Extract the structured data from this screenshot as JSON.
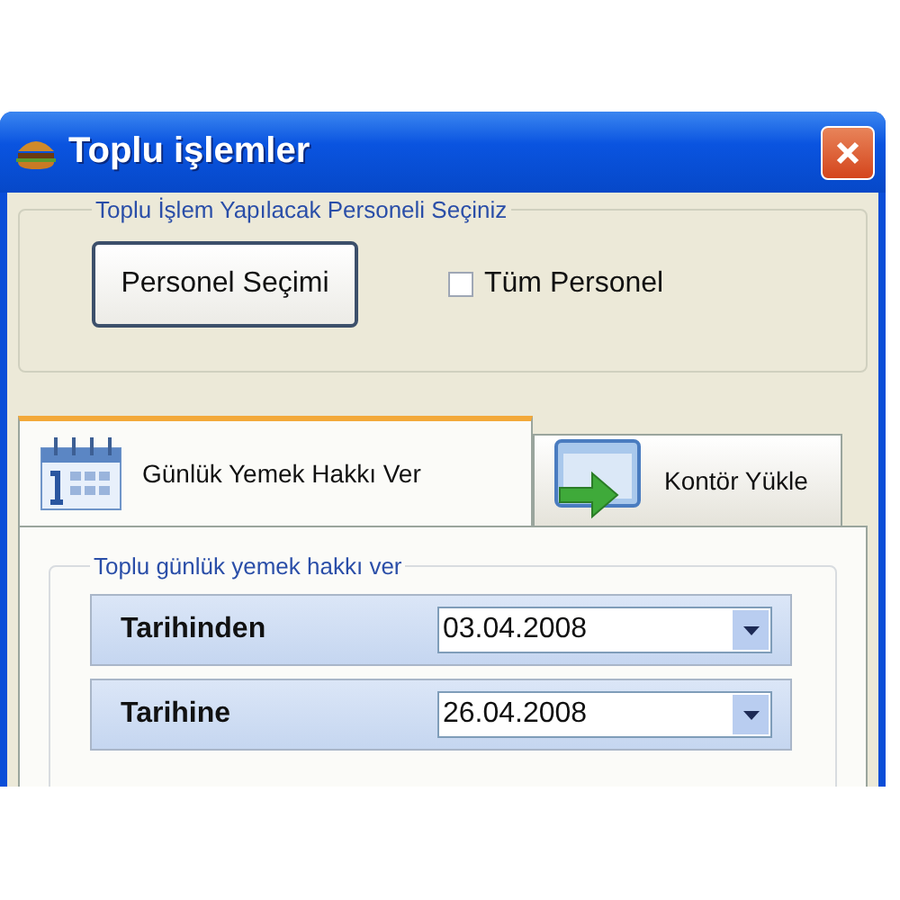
{
  "window": {
    "title": "Toplu işlemler"
  },
  "selection_group": {
    "title": "Toplu İşlem Yapılacak Personeli Seçiniz",
    "button": "Personel Seçimi",
    "checkbox": {
      "label": "Tüm Personel",
      "checked": false
    }
  },
  "tabs": [
    {
      "label": "Günlük Yemek Hakkı Ver",
      "selected": true,
      "kind": "calendar"
    },
    {
      "label": "Kontör Yükle",
      "selected": false,
      "kind": "transfer"
    }
  ],
  "panel": {
    "group_title": "Toplu günlük yemek hakkı ver",
    "rows": [
      {
        "label": "Tarihinden",
        "value": "03.04.2008"
      },
      {
        "label": "Tarihine",
        "value": "26.04.2008"
      }
    ]
  }
}
